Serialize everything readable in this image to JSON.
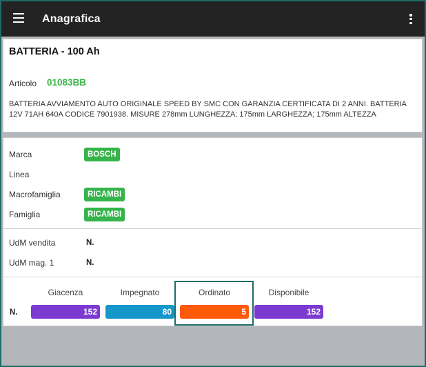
{
  "appbar": {
    "title": "Anagrafica",
    "menu_icon": "hamburger-menu-icon",
    "more_icon": "more-vert-icon"
  },
  "article": {
    "title": "BATTERIA - 100 Ah",
    "code_label": "Articolo",
    "code": "01083BB",
    "description": "BATTERIA AVVIAMENTO AUTO ORIGINALE SPEED BY SMC CON GARANZIA CERTIFICATA DI 2 ANNI. BATTERIA 12V 71AH 640A CODICE 7901938. MISURE 278mm LUNGHEZZA; 175mm LARGHEZZA; 175mm ALTEZZA"
  },
  "classification": [
    {
      "label": "Marca",
      "value": "BOSCH"
    },
    {
      "label": "Linea",
      "value": ""
    },
    {
      "label": "Macrofamiglia",
      "value": "RICAMBI"
    },
    {
      "label": "Famiglia",
      "value": "RICAMBI"
    }
  ],
  "units": [
    {
      "label": "UdM vendita",
      "value": "N."
    },
    {
      "label": "UdM mag. 1",
      "value": "N."
    }
  ],
  "stock": {
    "unit": "N.",
    "columns": [
      {
        "label": "Giacenza",
        "value": "152",
        "color": "#7b3bd1"
      },
      {
        "label": "Impegnato",
        "value": "80",
        "color": "#1597c9"
      },
      {
        "label": "Ordinato",
        "value": "5",
        "color": "#ff5a0a"
      },
      {
        "label": "Disponibile",
        "value": "152",
        "color": "#7b3bd1"
      }
    ]
  },
  "colors": {
    "appbar": "#232323",
    "code_green": "#3cb34a",
    "chip_green": "#35b44a",
    "frame": "#1f6b66",
    "background": "#b3b7bb"
  }
}
